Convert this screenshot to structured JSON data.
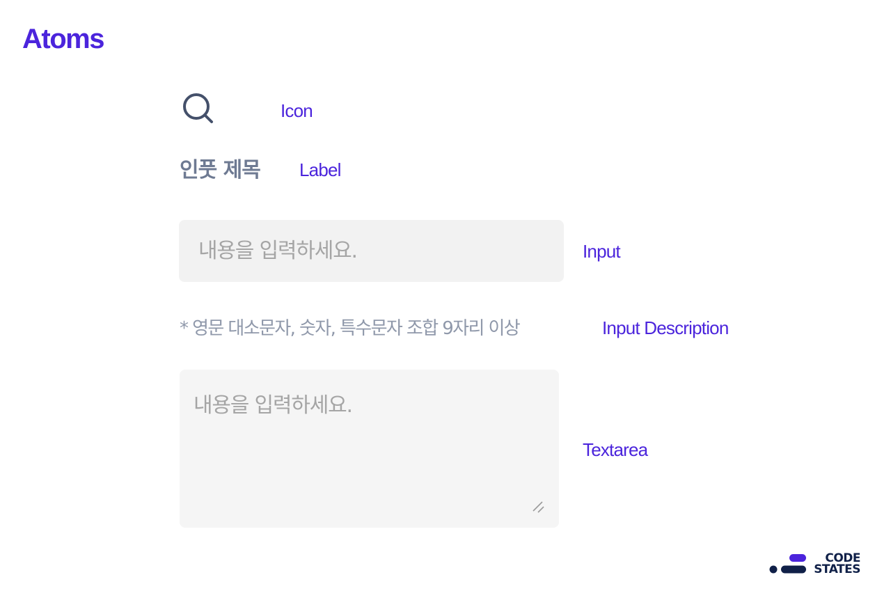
{
  "page": {
    "title": "Atoms"
  },
  "atoms": {
    "icon": {
      "icon_name": "search-icon",
      "tag": "Icon"
    },
    "label": {
      "text": "인풋 제목",
      "tag": "Label"
    },
    "input": {
      "placeholder": "내용을 입력하세요.",
      "value": "",
      "tag": "Input"
    },
    "input_description": {
      "text": "* 영문 대소문자, 숫자, 특수문자 조합 9자리 이상",
      "tag": "Input Description"
    },
    "textarea": {
      "placeholder": "내용을 입력하세요.",
      "value": "",
      "tag": "Textarea"
    }
  },
  "brand": {
    "line1": "CODE",
    "line2": "STATES"
  },
  "colors": {
    "accent": "#4b24dc",
    "label": "#6e7a92",
    "description": "#8f98aa",
    "field_bg": "#f2f2f2",
    "placeholder": "#a5a5a5",
    "icon_stroke": "#44506a",
    "logo_dark": "#102048"
  }
}
